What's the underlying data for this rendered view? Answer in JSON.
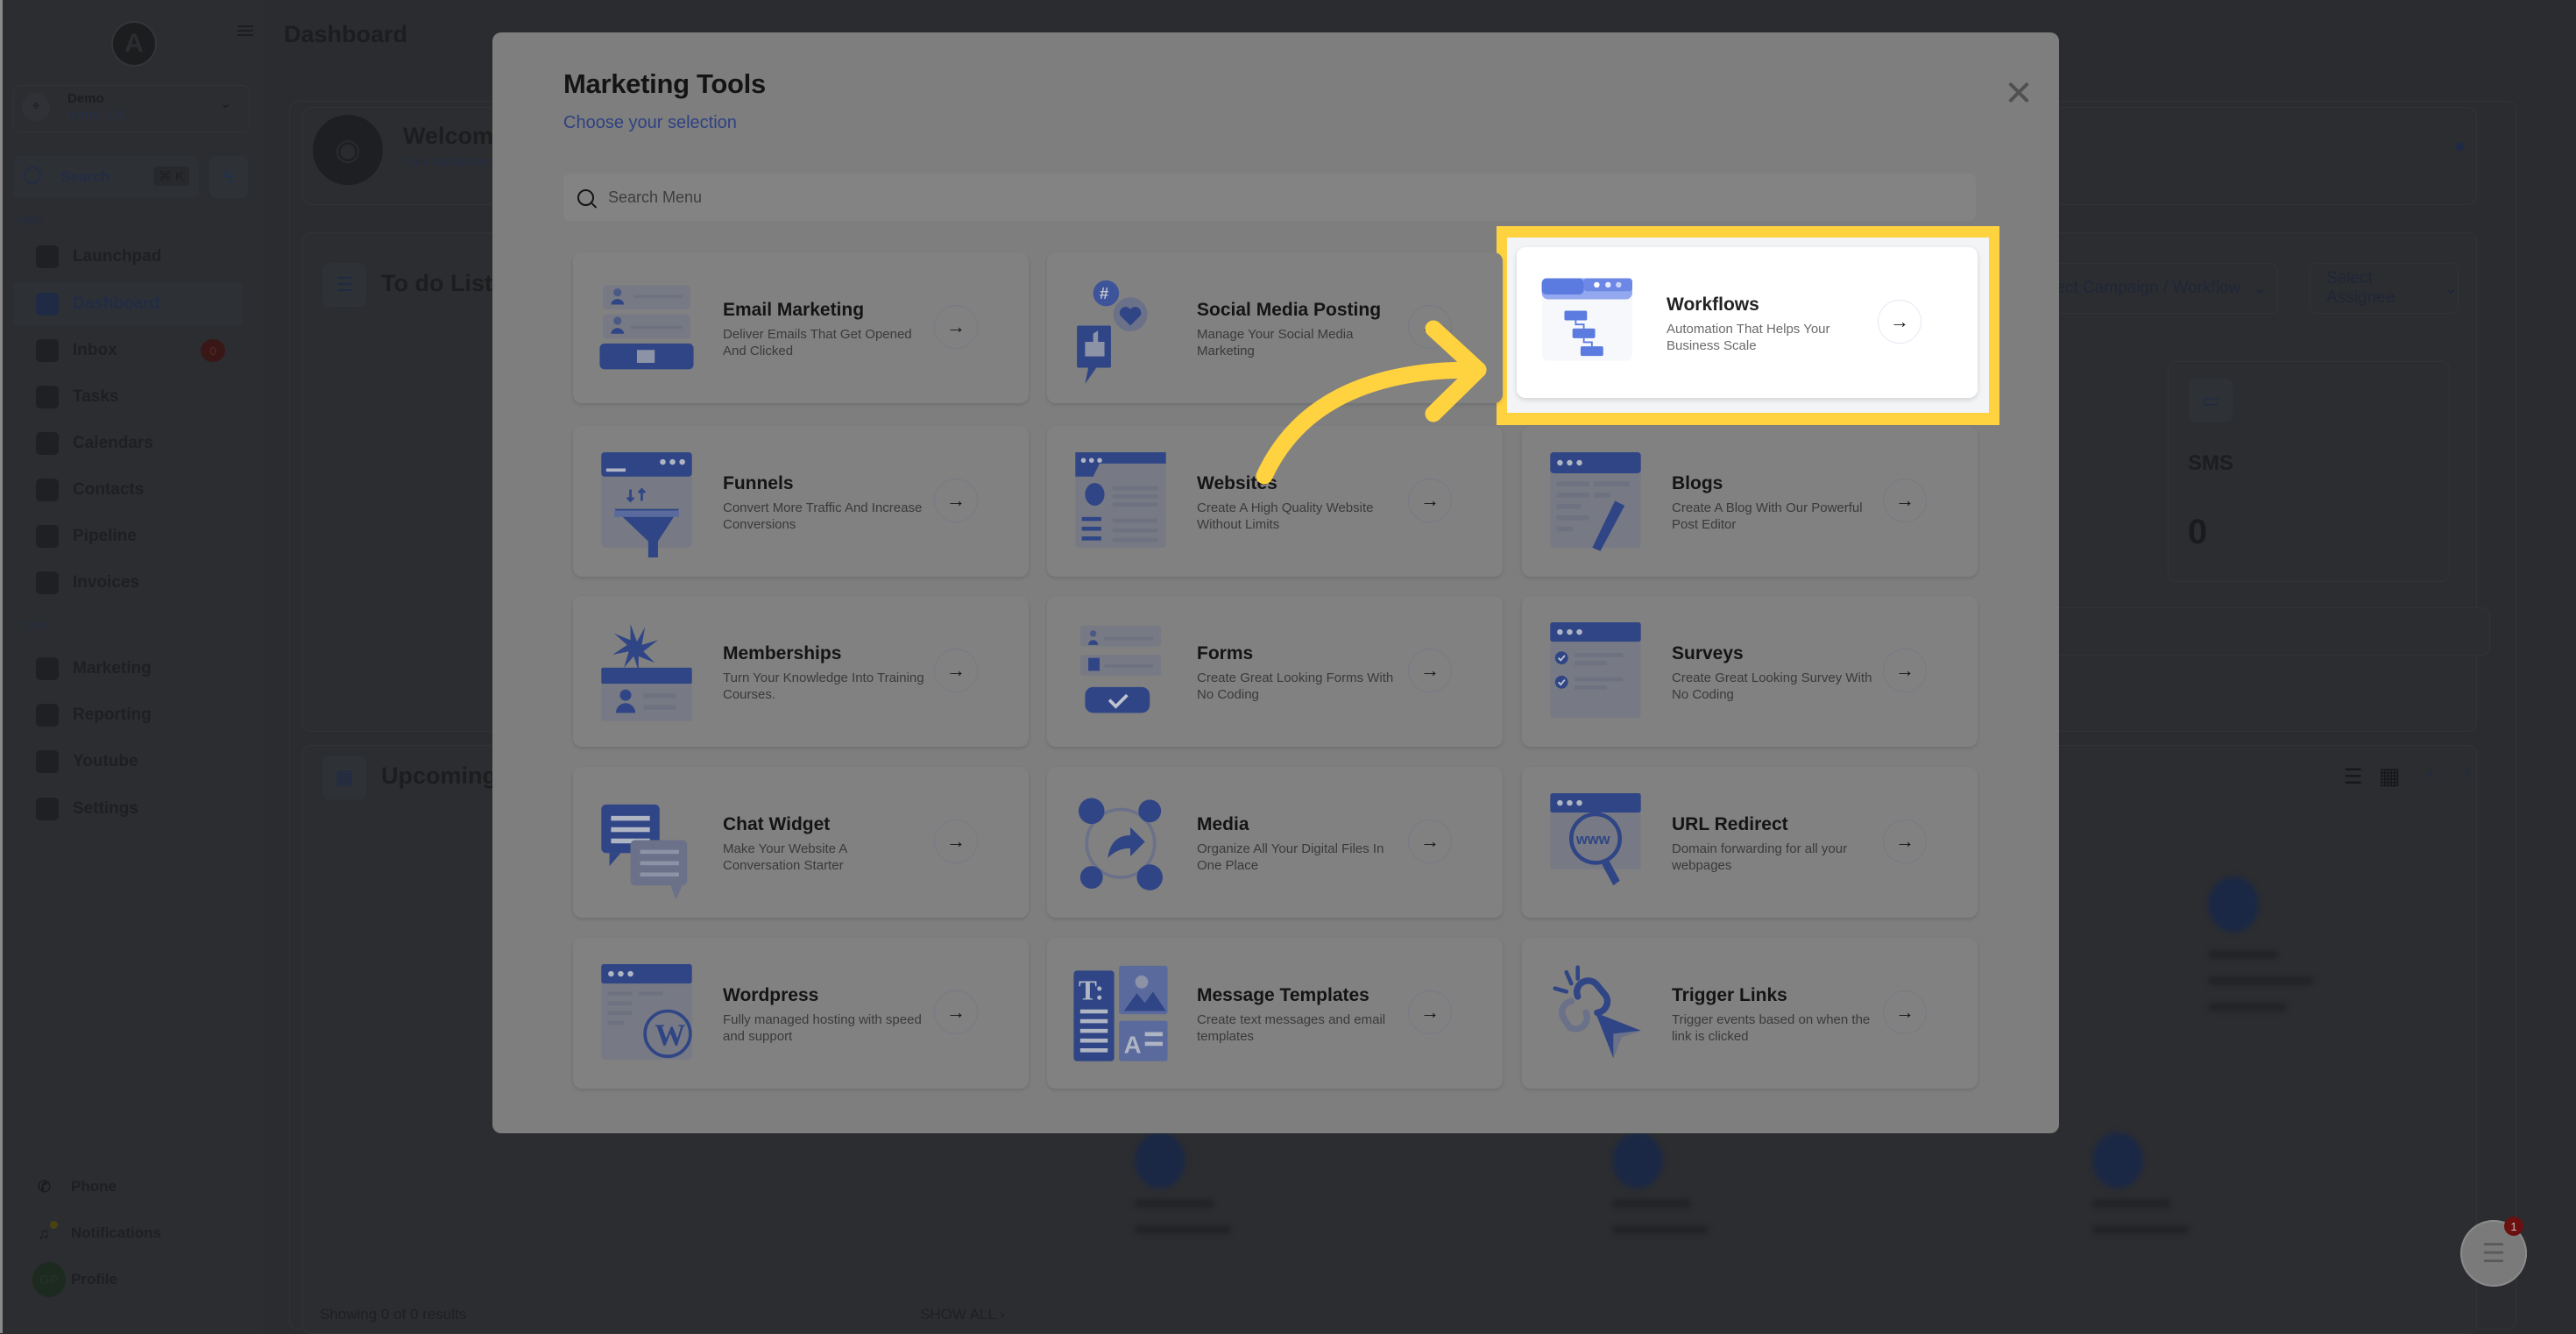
{
  "sidebar": {
    "account": {
      "name": "Demo",
      "location": "Irvine, CA"
    },
    "search": {
      "label": "Search",
      "shortcut": "⌘ K"
    },
    "apps_label": "Apps",
    "apps": [
      {
        "label": "Launchpad",
        "icon": "launchpad-icon"
      },
      {
        "label": "Dashboard",
        "icon": "dashboard-icon",
        "active": true
      },
      {
        "label": "Inbox",
        "icon": "inbox-icon",
        "badge": "0"
      },
      {
        "label": "Tasks",
        "icon": "tasks-icon"
      },
      {
        "label": "Calendars",
        "icon": "calendar-icon"
      },
      {
        "label": "Contacts",
        "icon": "contacts-icon"
      },
      {
        "label": "Pipeline",
        "icon": "pipeline-icon"
      },
      {
        "label": "Invoices",
        "icon": "invoices-icon"
      }
    ],
    "tools_label": "Tools",
    "tools": [
      {
        "label": "Marketing",
        "icon": "megaphone-icon"
      },
      {
        "label": "Reporting",
        "icon": "chart-pie-icon"
      },
      {
        "label": "Youtube",
        "icon": "youtube-icon"
      },
      {
        "label": "Settings",
        "icon": "gear-icon"
      }
    ],
    "footer": {
      "phone": "Phone",
      "notifications": "Notifications",
      "profile": "Profile",
      "avatar_initials": "GP"
    }
  },
  "header": {
    "title": "Dashboard"
  },
  "dashboard": {
    "welcome_title": "Welcome",
    "welcome_sub": "Your dashboard",
    "todo_title": "To do List",
    "campaign_select": "Select Campaign / Workflow",
    "assignee_select": "Select Assignee",
    "sms_label": "SMS",
    "sms_value": "0",
    "upcoming_title": "Upcoming",
    "results_text": "Showing 0 of 0 results",
    "show_all": "SHOW ALL"
  },
  "modal": {
    "title": "Marketing Tools",
    "subtitle": "Choose your selection",
    "search_placeholder": "Search Menu",
    "tools": [
      {
        "title": "Email Marketing",
        "desc": "Deliver Emails That Get Opened And Clicked",
        "icon": "email-marketing-icon"
      },
      {
        "title": "Social Media Posting",
        "desc": "Manage Your Social Media Marketing",
        "icon": "social-media-icon"
      },
      {
        "title": "Workflows",
        "desc": "Automation That Helps Your Business Scale",
        "icon": "workflows-icon",
        "highlighted": true
      },
      {
        "title": "Funnels",
        "desc": "Convert More Traffic And Increase Conversions",
        "icon": "funnel-icon"
      },
      {
        "title": "Websites",
        "desc": "Create A High Quality Website Without Limits",
        "icon": "website-icon"
      },
      {
        "title": "Blogs",
        "desc": "Create A Blog With Our Powerful Post Editor",
        "icon": "blog-icon"
      },
      {
        "title": "Memberships",
        "desc": "Turn Your Knowledge Into Training Courses.",
        "icon": "memberships-icon"
      },
      {
        "title": "Forms",
        "desc": "Create Great Looking Forms With No Coding",
        "icon": "forms-icon"
      },
      {
        "title": "Surveys",
        "desc": "Create Great Looking Survey With No Coding",
        "icon": "surveys-icon"
      },
      {
        "title": "Chat Widget",
        "desc": "Make Your Website A Conversation Starter",
        "icon": "chat-widget-icon"
      },
      {
        "title": "Media",
        "desc": "Organize All Your Digital Files In One Place",
        "icon": "media-icon"
      },
      {
        "title": "URL Redirect",
        "desc": "Domain forwarding for all your webpages",
        "icon": "url-redirect-icon"
      },
      {
        "title": "Wordpress",
        "desc": "Fully managed hosting with speed and support",
        "icon": "wordpress-icon"
      },
      {
        "title": "Message Templates",
        "desc": "Create text messages and email templates",
        "icon": "message-templates-icon"
      },
      {
        "title": "Trigger Links",
        "desc": "Trigger events based on when the link is clicked",
        "icon": "trigger-links-icon"
      }
    ]
  },
  "chat_widget": {
    "badge": "1"
  },
  "colors": {
    "highlight": "#ffd23f",
    "accent_blue": "#2e4282",
    "workflow_blue": "#5b7be0"
  }
}
